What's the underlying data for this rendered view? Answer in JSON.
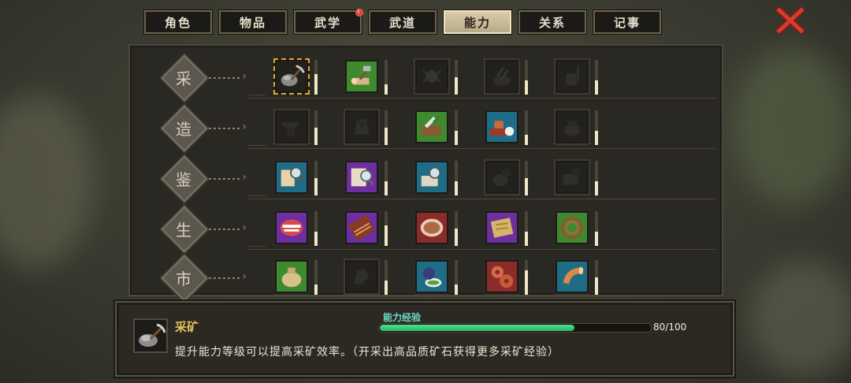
{
  "tabs": [
    {
      "label": "角色",
      "active": false,
      "badge": false
    },
    {
      "label": "物品",
      "active": false,
      "badge": false
    },
    {
      "label": "武学",
      "active": false,
      "badge": true
    },
    {
      "label": "武道",
      "active": false,
      "badge": false
    },
    {
      "label": "能力",
      "active": true,
      "badge": false
    },
    {
      "label": "关系",
      "active": false,
      "badge": false
    },
    {
      "label": "记事",
      "active": false,
      "badge": false
    }
  ],
  "categories": [
    {
      "label": "采",
      "skills": [
        {
          "icon": "pickaxe-ore-icon",
          "state": "selected",
          "color": "dark",
          "level": 0.6
        },
        {
          "icon": "axe-log-icon",
          "state": "lit",
          "color": "green",
          "level": 0.3
        },
        {
          "icon": "spider-icon",
          "state": "locked",
          "color": "dark",
          "level": 0.5
        },
        {
          "icon": "herb-basket-icon",
          "state": "locked",
          "color": "dark",
          "level": 0.4
        },
        {
          "icon": "fishing-icon",
          "state": "locked",
          "color": "dark",
          "level": 0.4
        }
      ]
    },
    {
      "label": "造",
      "skills": [
        {
          "icon": "anvil-icon",
          "state": "locked",
          "color": "dark",
          "level": 0.5
        },
        {
          "icon": "robe-icon",
          "state": "locked",
          "color": "dark",
          "level": 0.5
        },
        {
          "icon": "cleaver-board-icon",
          "state": "lit",
          "color": "green",
          "level": 0.4
        },
        {
          "icon": "alchemy-table-icon",
          "state": "lit",
          "color": "blue",
          "level": 0.3
        },
        {
          "icon": "pot-icon",
          "state": "locked",
          "color": "dark",
          "level": 0.4
        }
      ]
    },
    {
      "label": "鉴",
      "skills": [
        {
          "icon": "appraise-scroll-icon",
          "state": "lit",
          "color": "blue",
          "level": 0.5
        },
        {
          "icon": "appraise-book-icon",
          "state": "lit",
          "color": "purple",
          "level": 0.4
        },
        {
          "icon": "appraise-chest-icon",
          "state": "lit",
          "color": "blue",
          "level": 0.4
        },
        {
          "icon": "appraise-pot-icon",
          "state": "locked",
          "color": "dark",
          "level": 0.5
        },
        {
          "icon": "appraise-box-icon",
          "state": "locked",
          "color": "dark",
          "level": 0.4
        }
      ]
    },
    {
      "label": "生",
      "skills": [
        {
          "icon": "mouth-icon",
          "state": "lit",
          "color": "purple",
          "level": 0.4
        },
        {
          "icon": "abacus-icon",
          "state": "lit",
          "color": "purple",
          "level": 0.6
        },
        {
          "icon": "bowl-icon",
          "state": "lit",
          "color": "red",
          "level": 0.5
        },
        {
          "icon": "map-scroll-icon",
          "state": "lit",
          "color": "purple",
          "level": 0.4
        },
        {
          "icon": "whip-icon",
          "state": "lit",
          "color": "green",
          "level": 0.4
        }
      ]
    },
    {
      "label": "市",
      "skills": [
        {
          "icon": "money-bag-icon",
          "state": "lit",
          "color": "green",
          "level": 0.3
        },
        {
          "icon": "hand-icon",
          "state": "locked",
          "color": "dark",
          "level": 0.4
        },
        {
          "icon": "gourd-bowl-icon",
          "state": "lit",
          "color": "blue",
          "level": 0.3
        },
        {
          "icon": "gears-icon",
          "state": "lit",
          "color": "red",
          "level": 0.7
        },
        {
          "icon": "horn-icon",
          "state": "lit",
          "color": "blue",
          "level": 0.5
        }
      ]
    }
  ],
  "info": {
    "title": "采矿",
    "icon": "pickaxe-ore-icon",
    "exp_label": "能力经验",
    "exp_current": 80,
    "exp_max": 100,
    "exp_text": "80/100",
    "description": "提升能力等级可以提高采矿效率。（开采出高品质矿石获得更多采矿经验）"
  },
  "colors": {
    "accent": "#e8a732",
    "exp": "#35c878",
    "close": "#d33d2e"
  }
}
